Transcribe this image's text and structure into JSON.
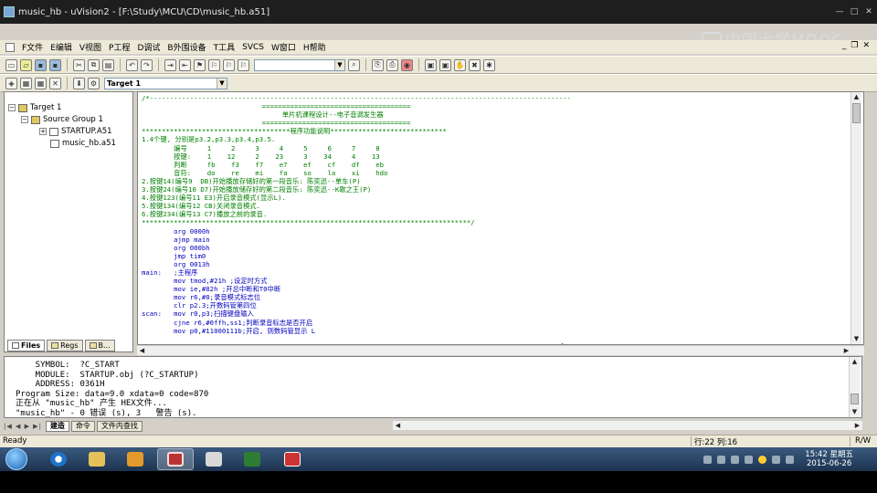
{
  "window": {
    "title": "music_hb - uVision2 - [F:\\Study\\MCU\\CD\\music_hb.a51]",
    "watermark": "中国大学MOOC"
  },
  "menu": {
    "items": [
      "F文件",
      "E编辑",
      "V视图",
      "P工程",
      "D调试",
      "B外围设备",
      "T工具",
      "SVCS",
      "W窗口",
      "H帮助"
    ]
  },
  "toolbar": {
    "search_value": "",
    "target_select": "Target 1"
  },
  "project_tree": {
    "target": "Target 1",
    "group": "Source Group 1",
    "files": [
      "STARTUP.A51",
      "music_hb.a51"
    ],
    "tabs": [
      "Files",
      "Regs",
      "B..."
    ]
  },
  "editor": {
    "lines": [
      "/*---------------------------------------------------------------------------------------------------------",
      "                              =====================================",
      "                                   单片机课程设计--电子音调发生器",
      "                              =====================================",
      "*************************************程序功能说明*****************************",
      "1.4个键, 分别是p3.2,p3.3,p3.4,p3.5.",
      "        编号     1     2     3     4     5     6     7     8",
      "        按键:    1    12     2    23     3    34     4    13",
      "        判断     fb    f3    f7    e7    ef    cf    df    eb",
      "        音符:    do    re    mi    fa    so    la    xi    hdo",
      "2.按键14(编号9  DB)开始播放存储好的第一段音乐: 陈奕迅--单车(P)",
      "3.按键24(编号10 D7)开始播放储存好的第二段音乐: 陈奕迅--K歌之王(P)",
      "4.按键123(编号11 E3)开启录音模式(显示L).",
      "5.按键134(编号12 CB)关闭录音模式.",
      "6.按键234(编号13 C7)播放之前的录音.",
      "**********************************************************************************/",
      "        org 0000h",
      "        ajmp main",
      "        org 000bh",
      "        jmp tim0",
      "        org 0013h",
      "main:   ;主程序",
      "        mov tmod,#21h ;设定时方式",
      "        mov ie,#82h ;开总中断和T0中断",
      "        mov r6,#0;录音模式标志位",
      "        clr p2.3;开数码管第四位",
      "scan:   mov r0,p3;扫描键盘输入",
      "        cjne r6,#0ffh,ss1;判断录音标志是否开启",
      "        mov p0,#11000111b;开启, 则数码管显示 L"
    ]
  },
  "output": {
    "lines": [
      "    SYMBOL:  ?C_START",
      "    MODULE:  STARTUP.obj (?C_STARTUP)",
      "    ADDRESS: 0361H",
      "Program Size: data=9.0 xdata=0 code=870",
      "正在从 \"music_hb\" 产生 HEX文件...",
      "\"music_hb\" - 0 错误 (s), 3   警告 (s)."
    ],
    "tabs": [
      "建造",
      "命令",
      "文件内查找"
    ]
  },
  "status": {
    "ready": "Ready",
    "position": "行:22 列:16",
    "mode": "R/W"
  },
  "taskbar": {
    "time": "15:42 星期五",
    "date": "2015-06-26"
  }
}
